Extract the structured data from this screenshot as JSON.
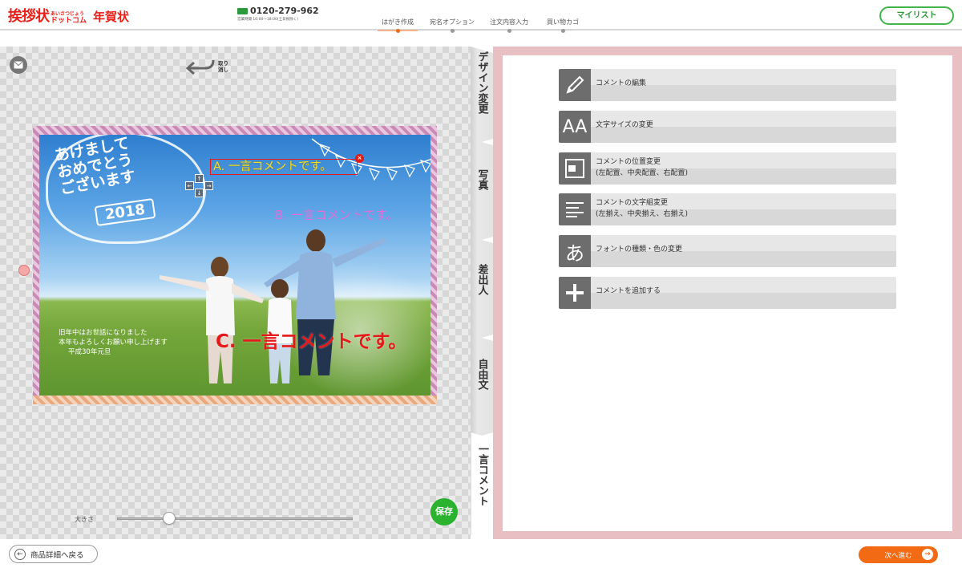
{
  "header": {
    "logo_main": "挨拶状",
    "logo_ruby": "あいさつじょう",
    "logo_dot": "ドットコム",
    "logo_product": "年賀状",
    "phone_number": "0120-279-962",
    "phone_hours": "営業時間 10:00～18:00(土日祝除く)",
    "steps": [
      "はがき作成",
      "宛名オプション",
      "注文内容入力",
      "買い物カゴ"
    ],
    "active_step": "はがき作成",
    "mylist_label": "マイリスト"
  },
  "editor": {
    "undo_label": "取り消し",
    "card": {
      "greeting_title": [
        "あけまして",
        "おめでとう",
        "ございます"
      ],
      "year_badge": "2018",
      "comment_a": "A. 一言コメントです。",
      "comment_b": "B. 一言コメントです。",
      "comment_c": "C. 一言コメントです。",
      "greeting_lines": [
        "旧年中はお世話になりました",
        "本年もよろしくお願い申し上げます",
        "平成30年元旦"
      ]
    },
    "size_label": "大きさ",
    "size_value": 0.22,
    "save_label": "保存"
  },
  "tabs": [
    {
      "label": "デザイン変更"
    },
    {
      "label": "写真"
    },
    {
      "label": "差出人"
    },
    {
      "label": "自由文"
    },
    {
      "label": "一言コメント"
    }
  ],
  "active_tab": "一言コメント",
  "panel": {
    "items": [
      {
        "icon": "pencil-icon",
        "line1": "コメントの編集",
        "line2": ""
      },
      {
        "icon": "font-size-icon",
        "glyph": "AA",
        "line1": "文字サイズの変更",
        "line2": ""
      },
      {
        "icon": "position-icon",
        "line1": "コメントの位置変更",
        "line2": "(左配置、中央配置、右配置)"
      },
      {
        "icon": "align-icon",
        "line1": "コメントの文字組変更",
        "line2": "(左揃え、中央揃え、右揃え)"
      },
      {
        "icon": "font-type-icon",
        "glyph": "あ",
        "line1": "フォントの種類・色の変更",
        "line2": ""
      },
      {
        "icon": "plus-icon",
        "line1": "コメントを追加する",
        "line2": ""
      }
    ]
  },
  "footer": {
    "back_label": "商品詳細へ戻る",
    "next_label": "次へ進む"
  },
  "colors": {
    "brand_red": "#e8201a",
    "accent_green": "#2bb330",
    "accent_orange": "#f26a13",
    "panel_frame": "#e8bfc2"
  }
}
